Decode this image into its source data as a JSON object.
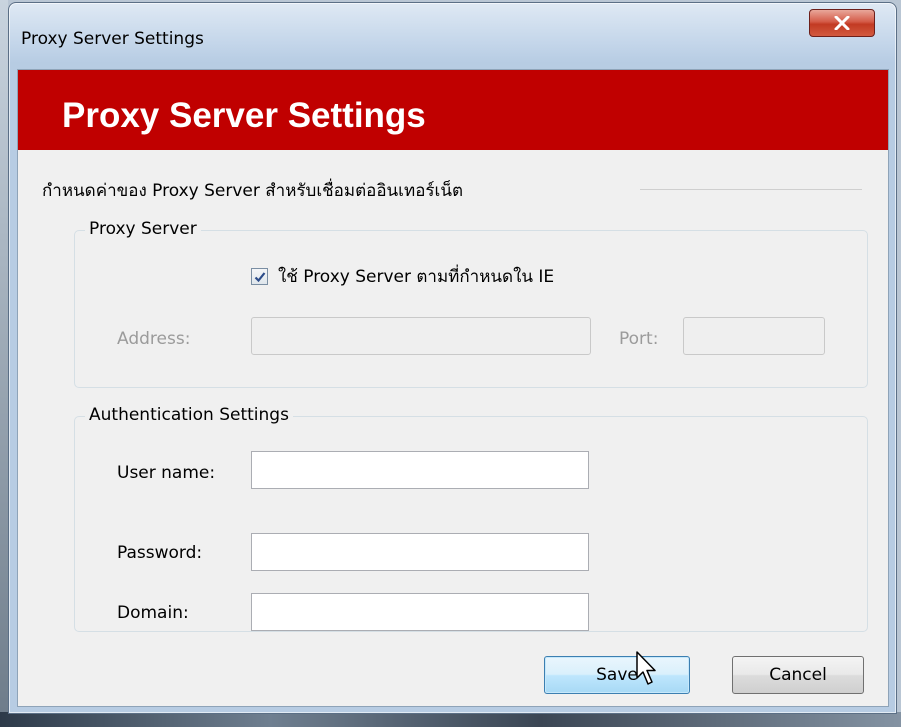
{
  "window": {
    "title": "Proxy Server Settings",
    "close_icon": "close-icon"
  },
  "banner": {
    "title": "Proxy Server Settings"
  },
  "description": "กำหนดค่าของ Proxy Server สำหรับเชื่อมต่ออินเทอร์เน็ต",
  "proxy_group": {
    "legend": "Proxy Server",
    "use_ie_checkbox": {
      "label": "ใช้ Proxy Server ตามที่กำหนดใน IE",
      "checked": true
    },
    "address_label": "Address:",
    "address_value": "",
    "port_label": "Port:",
    "port_value": ""
  },
  "auth_group": {
    "legend": "Authentication Settings",
    "username_label": "User name:",
    "username_value": "",
    "password_label": "Password:",
    "password_value": "",
    "domain_label": "Domain:",
    "domain_value": ""
  },
  "buttons": {
    "save": "Save",
    "cancel": "Cancel"
  },
  "colors": {
    "banner": "#c00000",
    "close_button": "#c23a23"
  }
}
